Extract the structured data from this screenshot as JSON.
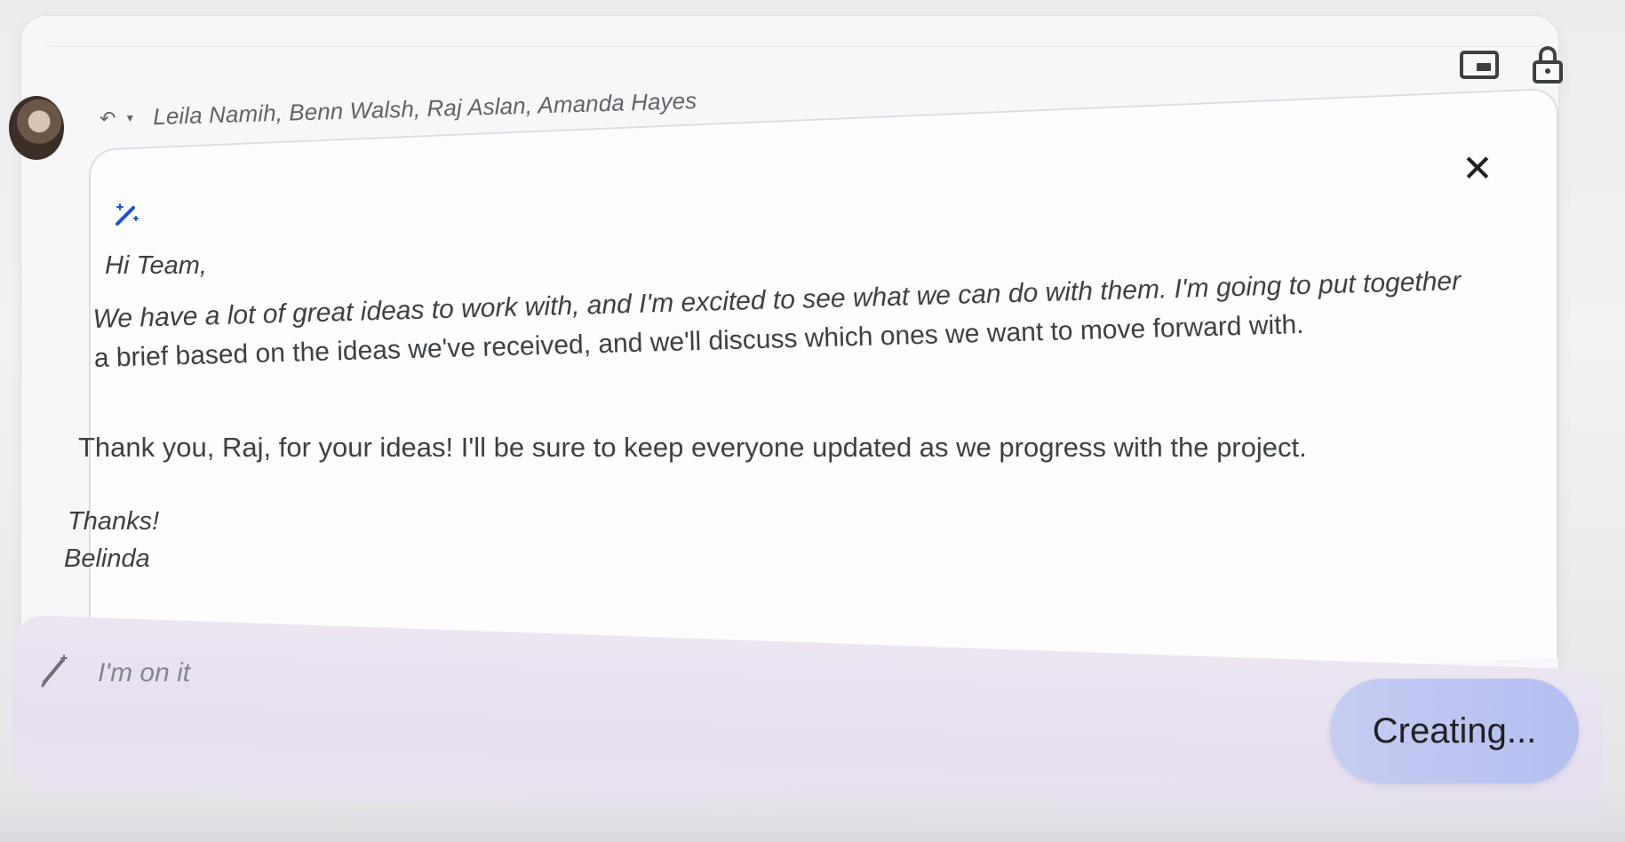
{
  "header": {
    "recipients": "Leila Namih, Benn Walsh, Raj Aslan, Amanda Hayes"
  },
  "icons": {
    "reply": "reply-icon",
    "dropdown": "chevron-down-icon",
    "pip": "picture-in-picture-icon",
    "lock": "lock-icon",
    "close": "close-icon",
    "sparkle": "magic-pen-icon",
    "pencil": "pencil-icon"
  },
  "draft": {
    "greeting": "Hi Team,",
    "paragraph1_line1": "We have a lot of great ideas to work with, and I'm excited to see what we can do with them. I'm going to put together",
    "paragraph1_line2": "a brief based on the ideas we've received, and we'll discuss which ones we want to move forward with.",
    "paragraph2": "Thank you, Raj, for your ideas! I'll be sure to keep everyone updated as we progress with the project.",
    "signoff": "Thanks!",
    "signature": "Belinda"
  },
  "prompt": {
    "value": "I'm on it",
    "button_label": "Creating..."
  },
  "colors": {
    "prompt_bar": "#e6def0",
    "button": "#bac4ef",
    "text": "#3c4043"
  }
}
